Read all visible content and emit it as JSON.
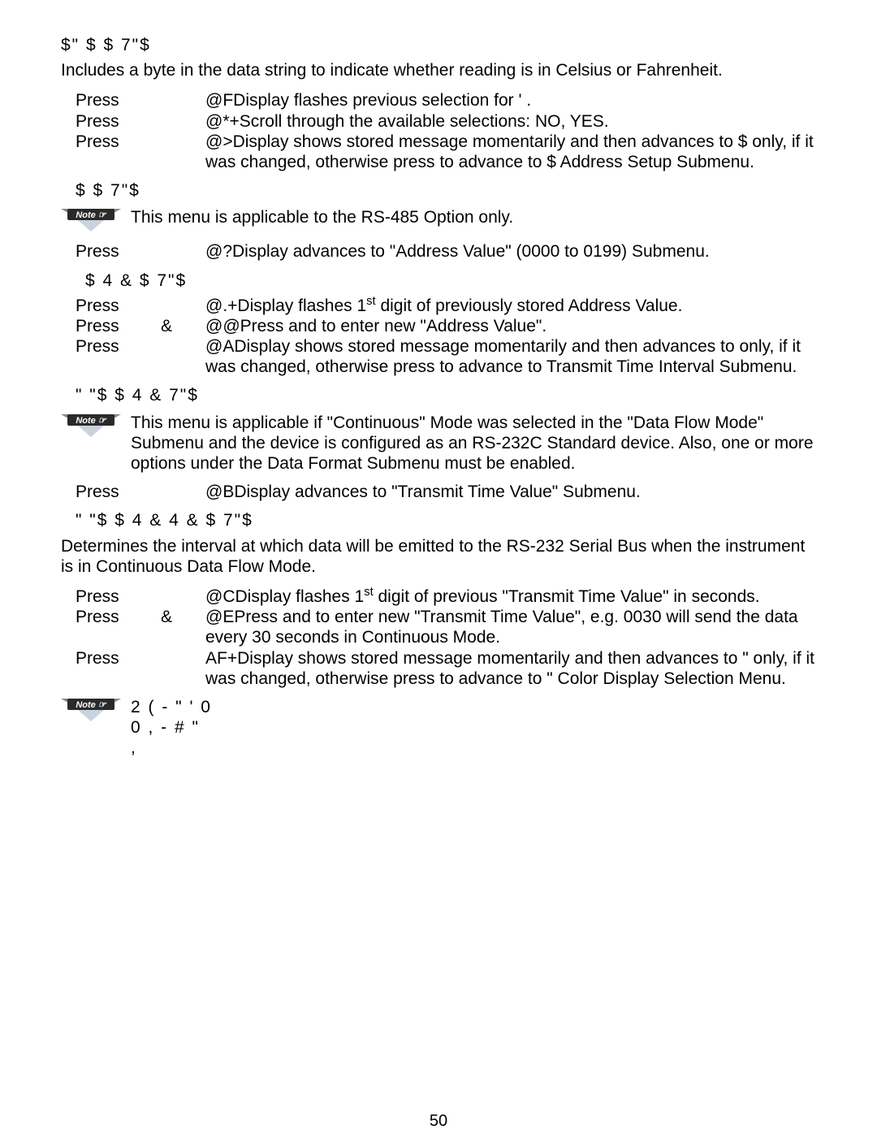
{
  "pageNumber": "50",
  "sec1": {
    "heading": "$\" $    $      7\"$",
    "intro": "Includes a byte in the data string to indicate whether reading is in Celsius or Fahrenheit.",
    "steps": [
      {
        "label": "Press",
        "mid": "@F",
        "desc": "Display flashes previous selection for '       ."
      },
      {
        "label": "Press",
        "mid": "@*+",
        "desc": "Scroll through the available selections: NO, YES."
      },
      {
        "label": "Press",
        "mid": "@>",
        "desc": "Display shows           stored message momentarily and then advances to $        only, if it was changed, otherwise press     to advance to $          Address Setup Submenu."
      }
    ]
  },
  "sec2": {
    "heading": "$    $     7\"$",
    "note": "This menu is applicable to the RS-485 Option only.",
    "steps": [
      {
        "label": "Press",
        "mid": "@?",
        "desc": "Display advances to \"Address Value\" (0000 to 0199) Submenu."
      }
    ]
  },
  "sec3": {
    "heading": "$   4 & $   7\"$",
    "steps": [
      {
        "label": "Press",
        "and": "",
        "mid": "@.+",
        "desc": "Display flashes 1",
        "sup": "st",
        "desc2": " digit of previously stored Address Value."
      },
      {
        "label": "Press",
        "and": "&",
        "mid": "@@",
        "desc": "Press     and     to enter new \"Address Value\"."
      },
      {
        "label": "Press",
        "and": "",
        "mid": "@A",
        "desc": "Display shows              stored message momentarily and then advances to            only, if it was changed, otherwise press     to advance to             Transmit Time Interval Submenu."
      }
    ]
  },
  "sec4": {
    "heading": "\"     \"$    $ 4 &   7\"$",
    "note": "This menu is applicable if \"Continuous\" Mode was selected in the \"Data Flow Mode\" Submenu and the device is configured as an RS-232C Standard device. Also, one or more options under the Data Format Submenu must be enabled.",
    "steps": [
      {
        "label": "Press",
        "mid": "@B",
        "desc": "Display advances to \"Transmit Time Value\" Submenu."
      }
    ]
  },
  "sec5": {
    "heading": "\"     \"$    $ 4 & 4 & $   7\"$",
    "intro": "Determines the interval at which data will be emitted to the RS-232 Serial Bus when the instrument is in Continuous Data Flow Mode.",
    "steps": [
      {
        "label": "Press",
        "and": "",
        "mid": "@C",
        "desc": "Display flashes 1",
        "sup": "st",
        "desc2": " digit of previous \"Transmit Time Value\" in seconds."
      },
      {
        "label": "Press",
        "and": "&",
        "mid": "@E",
        "desc": "Press     and     to enter new \"Transmit Time Value\", e.g. 0030 will send the data every 30 seconds in Continuous Mode."
      },
      {
        "label": "Press",
        "and": "",
        "mid": "AF+",
        "desc": "Display shows              stored message momentarily and then advances to  \"        only, if it was changed, otherwise press     to advance to  \"          Color Display Selection Menu."
      }
    ]
  },
  "bottomNote": {
    "line1": "2              (   -                    \"      '    0",
    "line2": "  0                ,        -                    #  \"",
    "line3": "                    ,"
  }
}
